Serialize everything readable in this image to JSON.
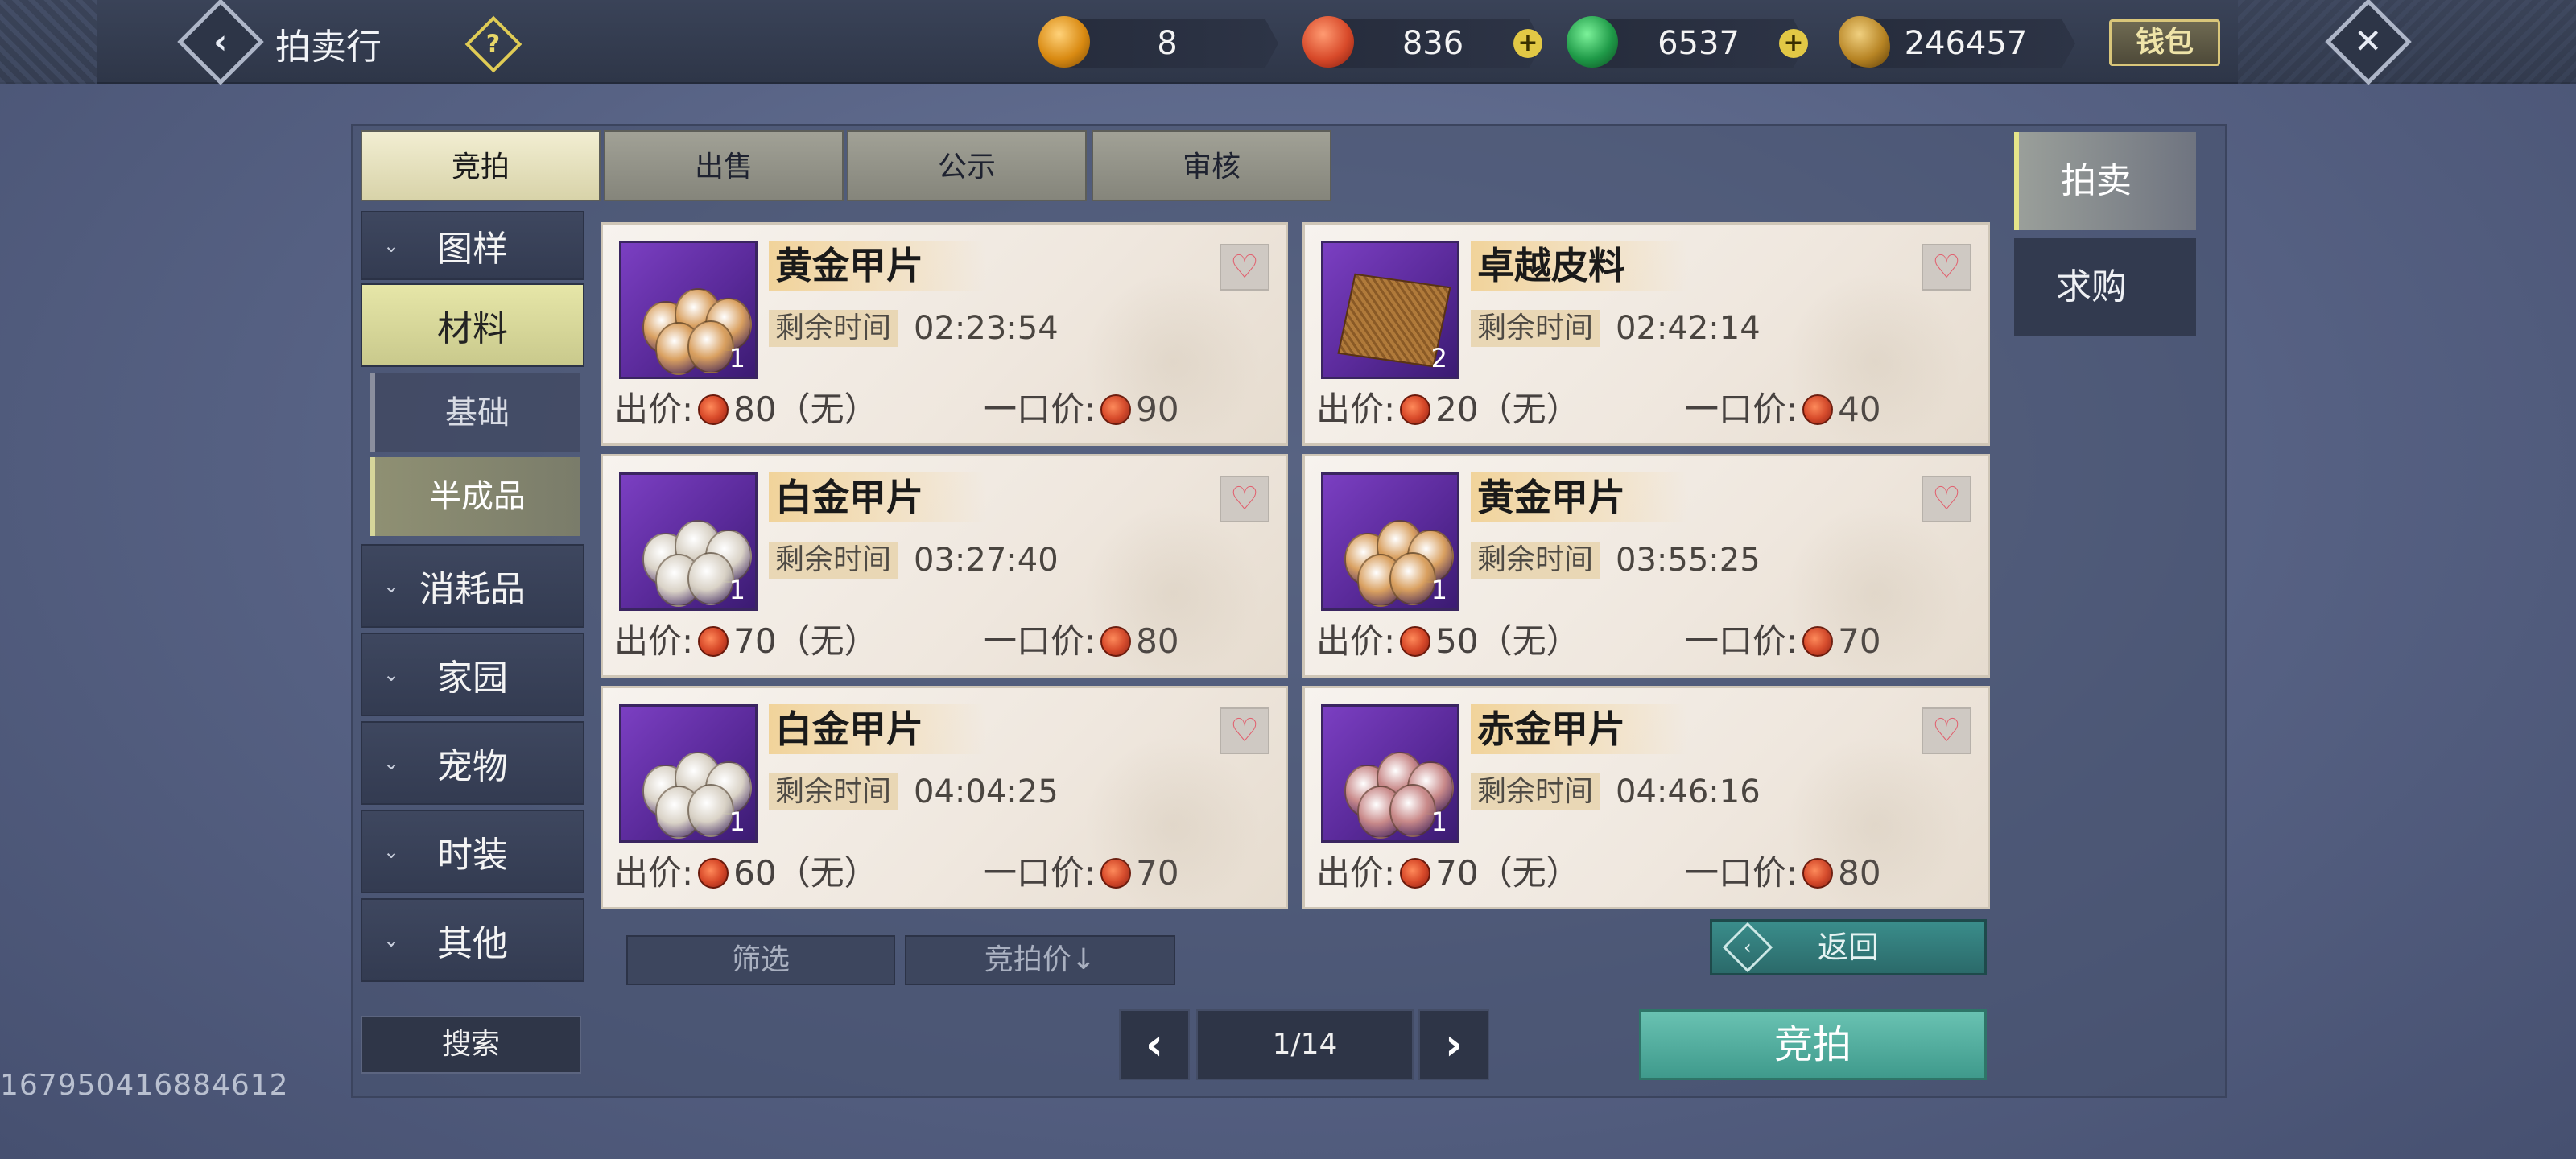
{
  "header": {
    "title": "拍卖行",
    "help_symbol": "?",
    "currencies": [
      {
        "icon": "gold-bell-icon",
        "value": "8"
      },
      {
        "icon": "red-coin-icon",
        "value": "836"
      },
      {
        "icon": "jade-coin-icon",
        "value": "6537"
      },
      {
        "icon": "gold-ingot-icon",
        "value": "246457"
      }
    ],
    "wallet_label": "钱包"
  },
  "tabs": [
    {
      "label": "竞拍",
      "active": true
    },
    {
      "label": "出售",
      "active": false
    },
    {
      "label": "公示",
      "active": false
    },
    {
      "label": "审核",
      "active": false
    }
  ],
  "sidebar": {
    "items": [
      {
        "label": "图样"
      },
      {
        "label": "材料",
        "active": true
      },
      {
        "label": "消耗品"
      },
      {
        "label": "家园"
      },
      {
        "label": "宠物"
      },
      {
        "label": "时装"
      },
      {
        "label": "其他"
      }
    ],
    "subitems": [
      {
        "label": "基础"
      },
      {
        "label": "半成品",
        "active": true
      }
    ]
  },
  "listings": [
    {
      "name": "黄金甲片",
      "qty": "1",
      "time_label": "剩余时间",
      "time": "02:23:54",
      "bid_label": "出价:",
      "bid": "80（无）",
      "buyout_label": "一口价:",
      "buyout": "90",
      "color": "#d9a060"
    },
    {
      "name": "卓越皮料",
      "qty": "2",
      "time_label": "剩余时间",
      "time": "02:42:14",
      "bid_label": "出价:",
      "bid": "20（无）",
      "buyout_label": "一口价:",
      "buyout": "40",
      "color": "#b07a3a"
    },
    {
      "name": "白金甲片",
      "qty": "1",
      "time_label": "剩余时间",
      "time": "03:27:40",
      "bid_label": "出价:",
      "bid": "70（无）",
      "buyout_label": "一口价:",
      "buyout": "80",
      "color": "#d9d2c6"
    },
    {
      "name": "黄金甲片",
      "qty": "1",
      "time_label": "剩余时间",
      "time": "03:55:25",
      "bid_label": "出价:",
      "bid": "50（无）",
      "buyout_label": "一口价:",
      "buyout": "70",
      "color": "#d9a060"
    },
    {
      "name": "白金甲片",
      "qty": "1",
      "time_label": "剩余时间",
      "time": "04:04:25",
      "bid_label": "出价:",
      "bid": "60（无）",
      "buyout_label": "一口价:",
      "buyout": "70",
      "color": "#d9d2c6"
    },
    {
      "name": "赤金甲片",
      "qty": "1",
      "time_label": "剩余时间",
      "time": "04:46:16",
      "bid_label": "出价:",
      "bid": "70（无）",
      "buyout_label": "一口价:",
      "buyout": "80",
      "color": "#c98a8a"
    }
  ],
  "controls": {
    "filter_label": "筛选",
    "sort_label": "竞拍价↓",
    "return_label": "返回",
    "search_label": "搜索",
    "page": "1/14",
    "bid_button_label": "竞拍"
  },
  "right_tabs": [
    {
      "label": "拍卖",
      "active": true
    },
    {
      "label": "求购",
      "active": false
    }
  ],
  "footer_id": "167950416884612"
}
